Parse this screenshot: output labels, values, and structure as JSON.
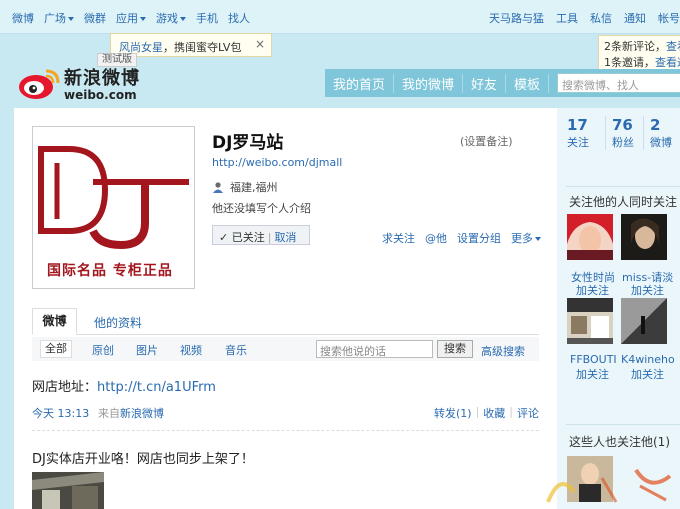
{
  "topnav": {
    "left": [
      {
        "label": "微博"
      },
      {
        "label": "广场",
        "dropdown": true
      },
      {
        "label": "微群"
      },
      {
        "label": "应用",
        "dropdown": true
      },
      {
        "label": "游戏",
        "dropdown": true
      },
      {
        "label": "手机"
      },
      {
        "label": "找人"
      }
    ],
    "right": [
      "天马路与猛",
      "工具",
      "私信",
      "通知",
      "帐号"
    ]
  },
  "tip": {
    "highlight": "风尚女星",
    "text": "，携闺蜜夺LV包",
    "close": "×",
    "tab": "测试版"
  },
  "notice": {
    "line1_count": "2条新评论，",
    "line1_link": "查看评",
    "line2_count": "1条邀请，",
    "line2_link": "查看邀"
  },
  "logo": {
    "cn": "新浪微博",
    "en": "weibo.com"
  },
  "mainnav": {
    "items": [
      "我的首页",
      "我的微博",
      "好友",
      "模板"
    ],
    "search_placeholder": "搜索微博、找人"
  },
  "profile": {
    "name": "DJ罗马站",
    "remark": "(设置备注)",
    "url": "http://weibo.com/djmall",
    "location": "福建,福州",
    "bio": "他还没填写个人介绍",
    "followed": "✓ 已关注",
    "cancel": "取消",
    "actions": [
      "求关注",
      "@他",
      "设置分组"
    ],
    "more": "更多",
    "avatar_slogan": "国际名品 专柜正品"
  },
  "tabs": {
    "active": "微博",
    "other": "他的资料"
  },
  "filters": {
    "all": "全部",
    "items": [
      "原创",
      "图片",
      "视频",
      "音乐"
    ],
    "search_placeholder": "搜索他说的话",
    "search_button": "搜索",
    "advanced": "高级搜索"
  },
  "post1": {
    "text": "网店地址：",
    "link": "http://t.cn/a1UFrm",
    "time": "今天  13:13",
    "from_prefix": "来自",
    "from": "新浪微博",
    "repost": "转发(1)",
    "favorite": "收藏",
    "comment": "评论"
  },
  "post2": {
    "text": "DJ实体店开业咯！网店也同步上架了！"
  },
  "sidebar": {
    "stats": [
      {
        "num": "17",
        "label": "关注"
      },
      {
        "num": "76",
        "label": "粉丝"
      },
      {
        "num": "2",
        "label": "微博"
      }
    ],
    "common_title": "关注他的人同时关注",
    "users": [
      {
        "name": "女性时尚",
        "add": "加关注"
      },
      {
        "name": "miss-请淡",
        "add": "加关注"
      },
      {
        "name": "FFBOUTI",
        "add": "加关注"
      },
      {
        "name": "K4wineho",
        "add": "加关注"
      }
    ],
    "also_title": "这些人也关注他(1)"
  },
  "colors": {
    "brand_red": "#a3161e",
    "link": "#2a6bb0",
    "nav": "#7fc6da"
  }
}
